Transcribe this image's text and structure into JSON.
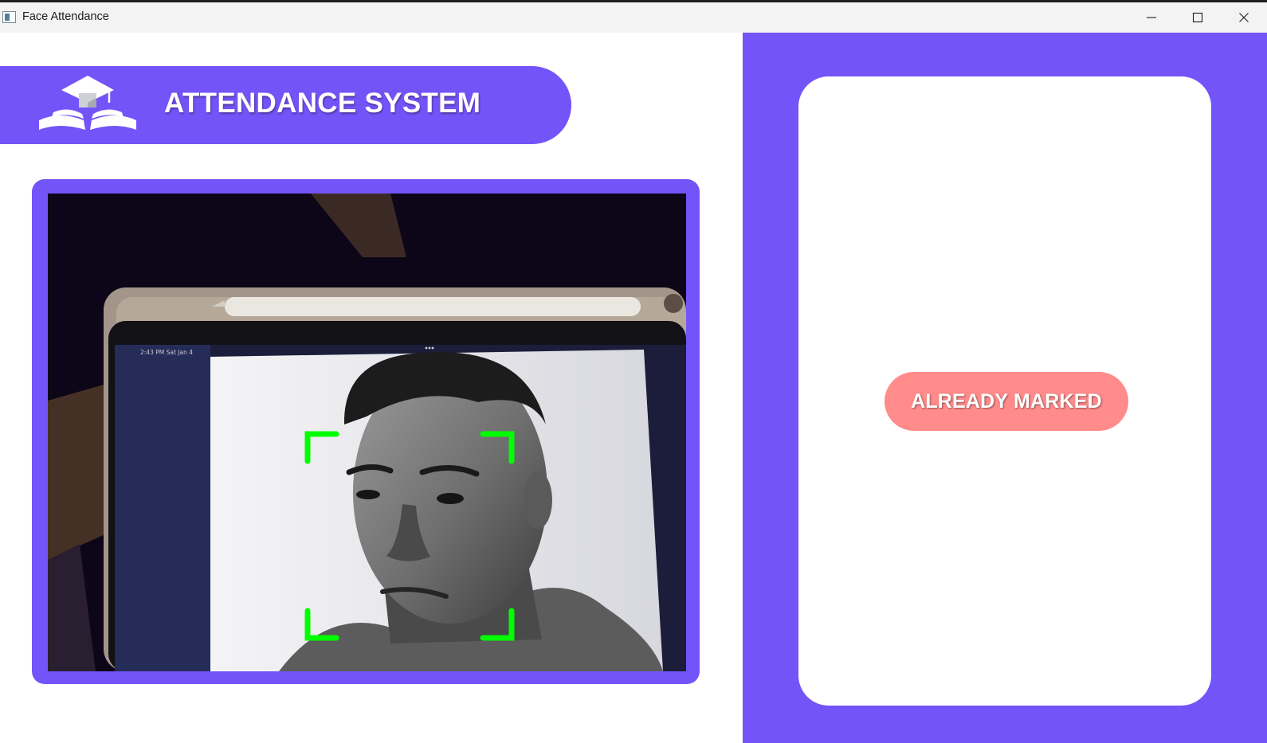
{
  "window": {
    "title": "Face Attendance",
    "icon": "app-window-icon",
    "controls": [
      "minimize-icon",
      "maximize-icon",
      "close-icon"
    ]
  },
  "header": {
    "title": "ATTENDANCE SYSTEM",
    "logo": "graduation-cap-book-icon"
  },
  "camera": {
    "label": "webcam-feed",
    "face_detected": true,
    "status_bar_text": "2:43 PM  Sat Jan 4"
  },
  "status": {
    "label": "ALREADY MARKED"
  },
  "colors": {
    "accent": "#7354f8",
    "status_bg": "#ff8b8b",
    "detection_box": "#00ff00",
    "card": "#ffffff"
  }
}
